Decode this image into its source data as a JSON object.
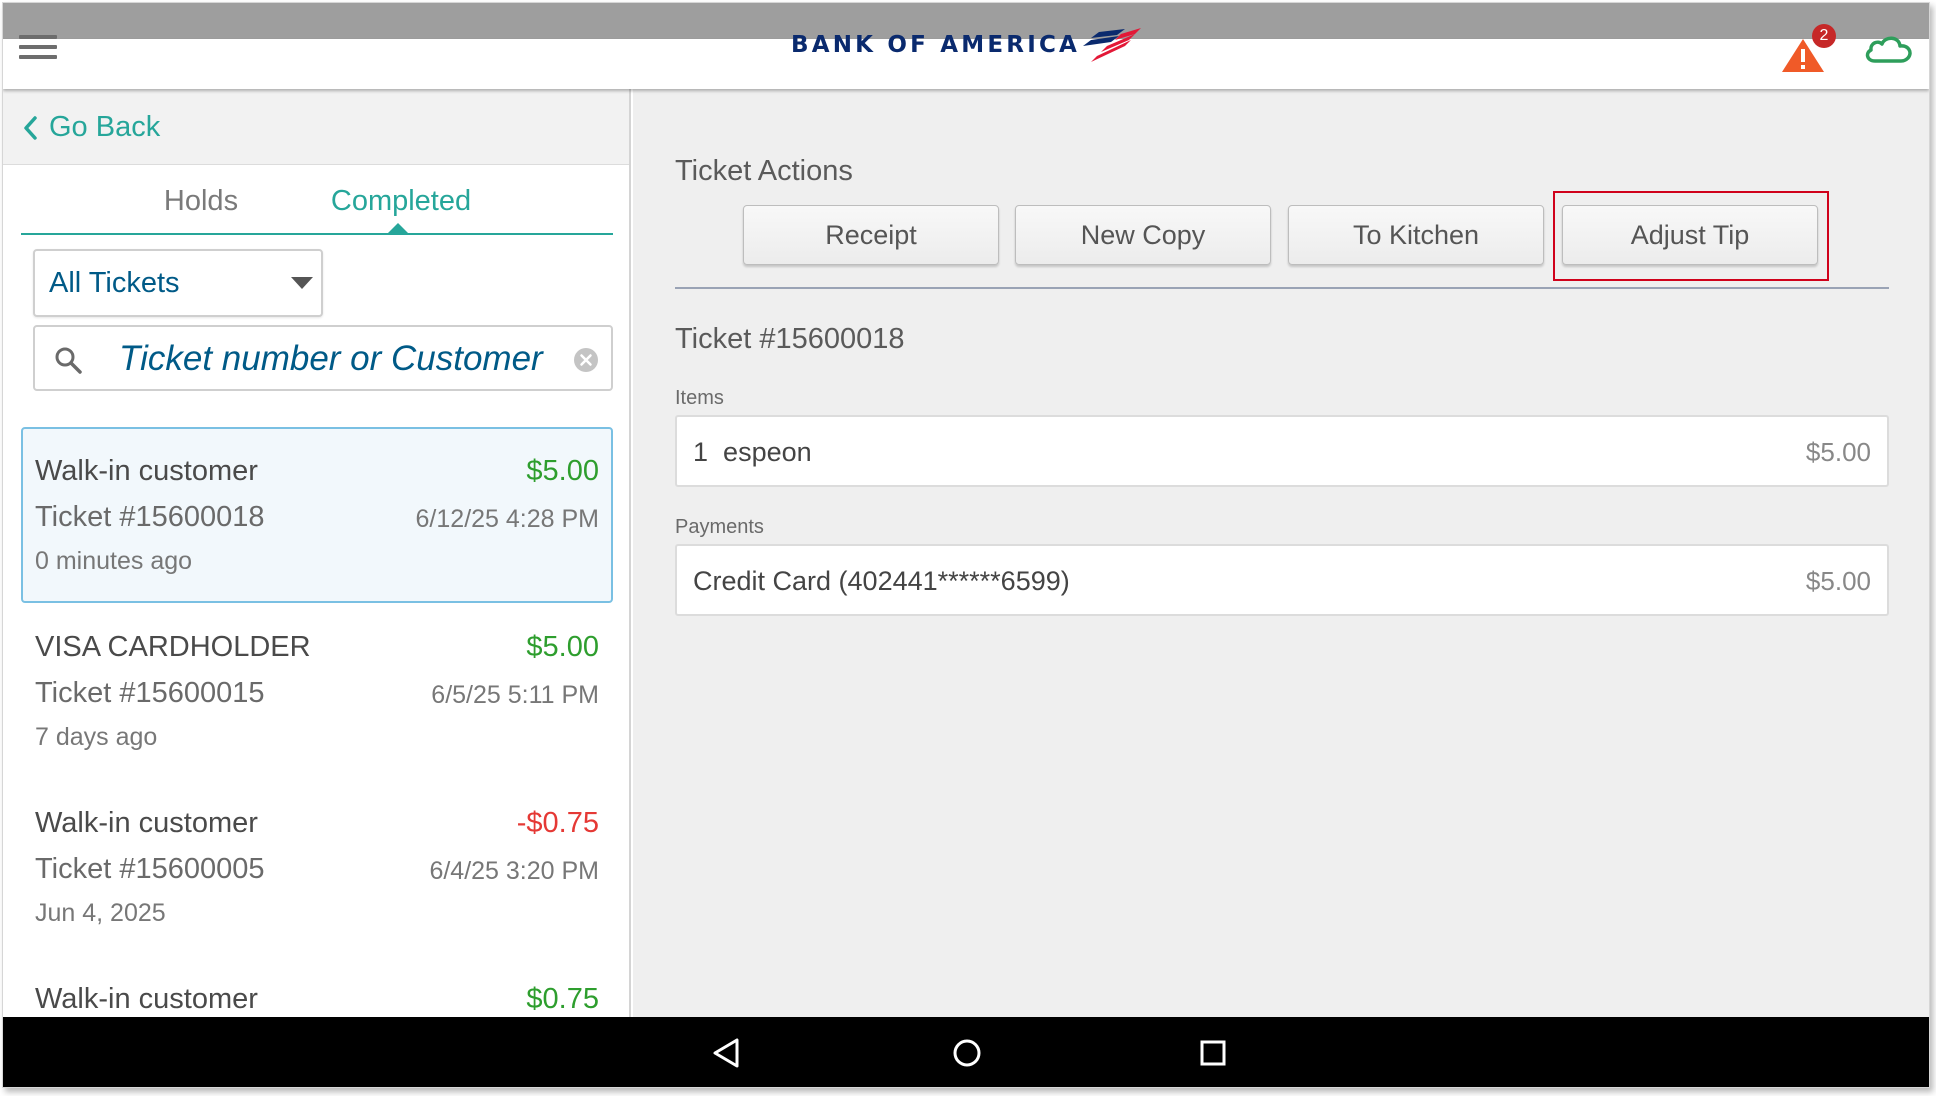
{
  "header": {
    "brand_name": "BANK OF AMERICA",
    "alert_count": "2",
    "colors": {
      "brand_navy": "#0a2a6e",
      "brand_red": "#e31837",
      "alert_orange": "#f05a28",
      "cloud_green": "#2e9e5b"
    }
  },
  "left": {
    "go_back_label": "Go Back",
    "tabs": [
      {
        "label": "Holds"
      },
      {
        "label": "Completed"
      }
    ],
    "active_tab": "Completed",
    "filter": {
      "selected": "All Tickets"
    },
    "search": {
      "placeholder": "Ticket number or Customer",
      "value": ""
    },
    "tickets": [
      {
        "customer": "Walk-in customer",
        "amount": "$5.00",
        "ticket": "Ticket #15600018",
        "datetime": "6/12/25 4:28 PM",
        "age": "0 minutes ago"
      },
      {
        "customer": "VISA CARDHOLDER",
        "amount": "$5.00",
        "ticket": "Ticket #15600015",
        "datetime": "6/5/25 5:11 PM",
        "age": "7 days ago"
      },
      {
        "customer": "Walk-in customer",
        "amount": "-$0.75",
        "ticket": "Ticket #15600005",
        "datetime": "6/4/25 3:20 PM",
        "age": "Jun 4, 2025"
      },
      {
        "customer": "Walk-in customer",
        "amount": "$0.75",
        "ticket": "",
        "datetime": "",
        "age": ""
      }
    ]
  },
  "right": {
    "actions_title": "Ticket Actions",
    "actions": {
      "receipt": "Receipt",
      "new_copy": "New Copy",
      "to_kitchen": "To Kitchen",
      "adjust_tip": "Adjust Tip"
    },
    "ticket_number": "Ticket #15600018",
    "items_label": "Items",
    "items": [
      {
        "qty": "1",
        "name": "espeon",
        "price": "$5.00"
      }
    ],
    "payments_label": "Payments",
    "payments": [
      {
        "method": "Credit Card (402441******6599)",
        "amount": "$5.00"
      }
    ]
  }
}
